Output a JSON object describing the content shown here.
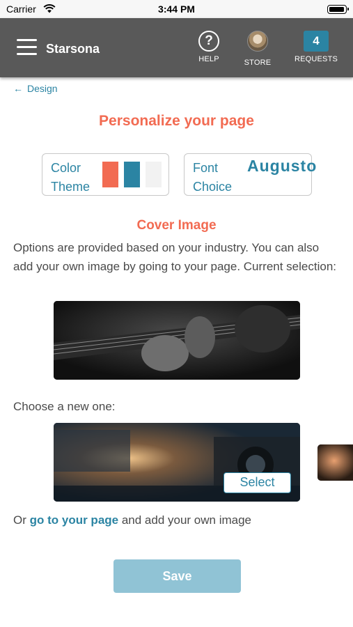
{
  "status_bar": {
    "carrier": "Carrier",
    "time": "3:44 PM"
  },
  "header": {
    "brand": "Starsona",
    "help_label": "HELP",
    "store_label": "STORE",
    "requests_label": "REQUESTS",
    "requests_count": "4"
  },
  "back_link": {
    "label": "Design"
  },
  "page_title": "Personalize your page",
  "color_theme": {
    "label": "Color Theme",
    "swatches": [
      "#f26b52",
      "#2b84a3",
      "#f2f2f2"
    ]
  },
  "font_choice": {
    "label": "Font Choice",
    "sample": "Augusto"
  },
  "cover": {
    "heading": "Cover Image",
    "description": "Options are provided based on your industry. You can also add your own image by going to your page. Current selection:",
    "choose_label": "Choose a new one:",
    "select_label": "Select",
    "own_prefix": "Or ",
    "own_link": "go to your page",
    "own_suffix": " and add your own image"
  },
  "save_label": "Save",
  "colors": {
    "accent": "#2b84a3",
    "heading": "#f26b52",
    "header_bg": "#595959",
    "save_bg": "#90c3d5"
  }
}
